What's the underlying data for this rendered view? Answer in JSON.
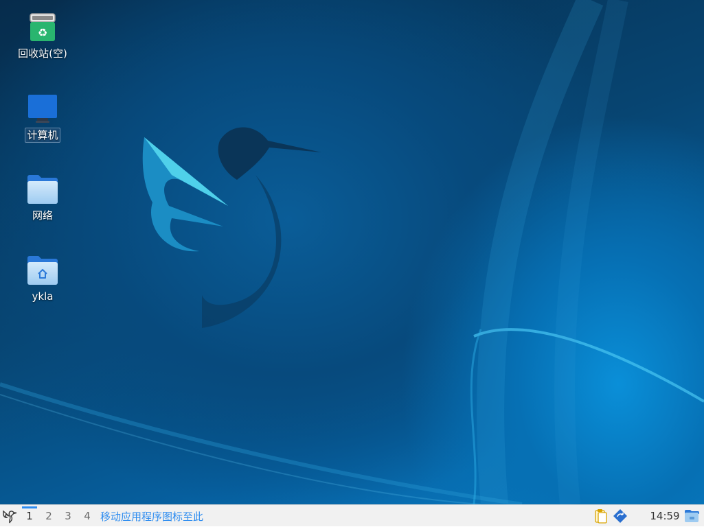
{
  "desktop": {
    "icons": [
      {
        "label": "回收站(空)",
        "icon": "trash-empty-icon"
      },
      {
        "label": "计算机",
        "icon": "computer-icon"
      },
      {
        "label": "网络",
        "icon": "network-folder-icon"
      },
      {
        "label": "ykla",
        "icon": "home-folder-icon"
      }
    ]
  },
  "taskbar": {
    "start_icon": "bird-menu-icon",
    "workspaces": [
      "1",
      "2",
      "3",
      "4"
    ],
    "active_workspace": "1",
    "task_hint": "移动应用程序图标至此",
    "tray_icons": [
      "clipboard-icon",
      "update-icon"
    ],
    "clock": "14:59",
    "show_desktop_icon": "show-desktop-icon"
  },
  "colors": {
    "accent": "#2d8cf0",
    "taskbar_bg": "#f1f1f1",
    "wallpaper_dark": "#062c4c",
    "wallpaper_light": "#0a8fd8"
  }
}
